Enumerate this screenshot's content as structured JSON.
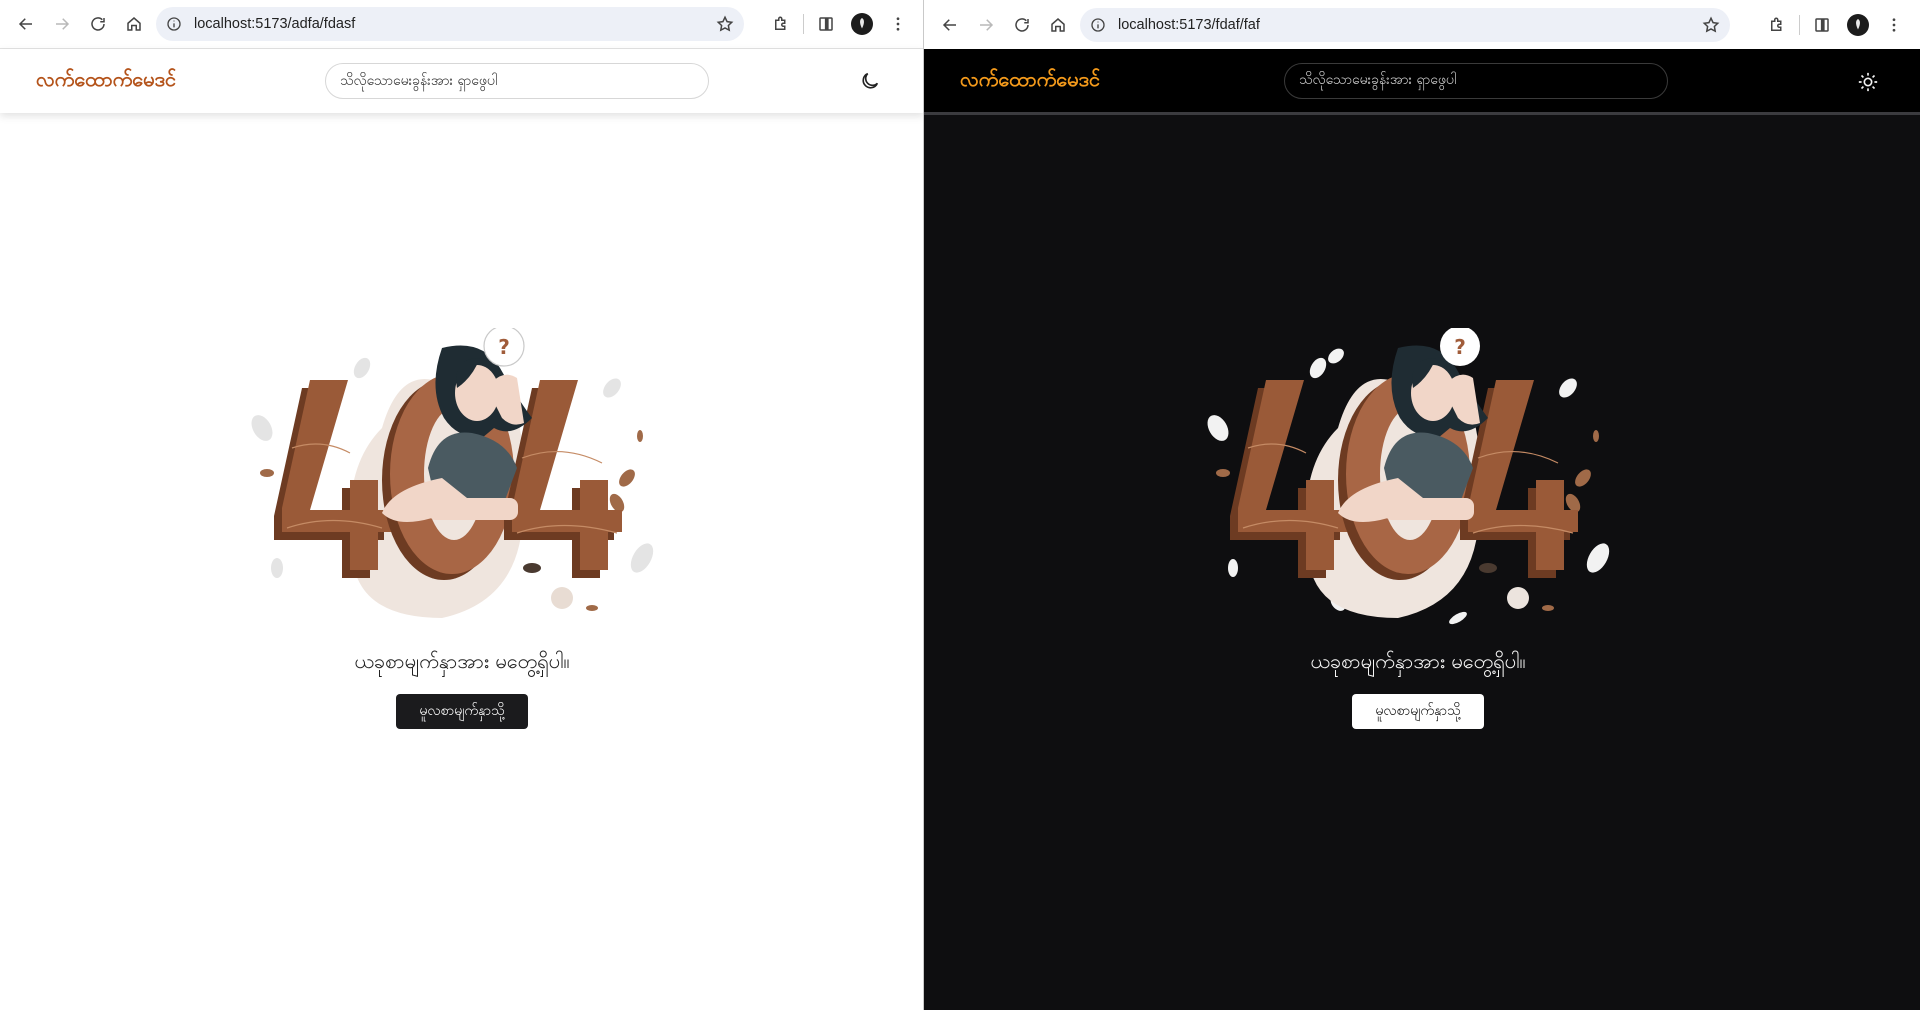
{
  "windows": [
    {
      "theme": "light",
      "url": "localhost:5173/adfa/fdasf",
      "site": {
        "brand": "လက်ထောက်မေဒင်",
        "search_placeholder": "သိလိုသောမေးခွန်းအား ရှာဖွေပါ",
        "theme_toggle_icon": "moon-icon"
      },
      "content": {
        "illustration": "404-illustration",
        "message": "ယခုစာမျက်နှာအား မတွေ့ရှိပါ။",
        "home_button": "မူလစာမျက်နှာသို့"
      }
    },
    {
      "theme": "dark",
      "url": "localhost:5173/fdaf/faf",
      "site": {
        "brand": "လက်ထောက်မေဒင်",
        "search_placeholder": "သိလိုသောမေးခွန်းအား ရှာဖွေပါ",
        "theme_toggle_icon": "sun-icon"
      },
      "content": {
        "illustration": "404-illustration",
        "message": "ယခုစာမျက်နှာအား မတွေ့ရှိပါ။",
        "home_button": "မူလစာမျက်နှာသို့"
      }
    }
  ],
  "colors": {
    "brand_light": "#b4531a",
    "brand_dark": "#f49a1b",
    "digit_brown": "#9a5a38",
    "digit_dark": "#6d3b22",
    "dark_bg": "#0e0e10"
  },
  "illustration_text": "?"
}
